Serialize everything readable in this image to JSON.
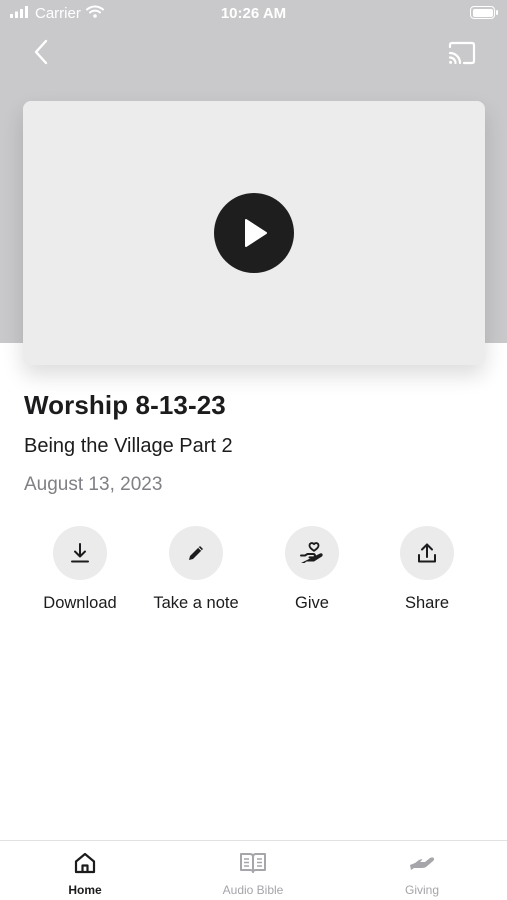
{
  "status_bar": {
    "carrier": "Carrier",
    "time": "10:26 AM"
  },
  "header": {
    "back_icon": "chevron-left-icon",
    "cast_icon": "cast-icon"
  },
  "video": {
    "play_icon": "play-icon"
  },
  "sermon": {
    "title": "Worship 8-13-23",
    "subtitle": "Being the Village Part 2",
    "date": "August 13, 2023"
  },
  "actions": [
    {
      "label": "Download",
      "icon": "download-icon"
    },
    {
      "label": "Take a note",
      "icon": "pencil-icon"
    },
    {
      "label": "Give",
      "icon": "heart-hand-icon"
    },
    {
      "label": "Share",
      "icon": "share-icon"
    }
  ],
  "tabs": [
    {
      "label": "Home",
      "icon": "home-icon",
      "active": true
    },
    {
      "label": "Audio Bible",
      "icon": "book-icon",
      "active": false
    },
    {
      "label": "Giving",
      "icon": "giving-hand-icon",
      "active": false
    }
  ],
  "colors": {
    "hero_background": "#c9c9cb",
    "video_background": "#ececed",
    "play_button": "#1e1e1e",
    "action_circle": "#ebebec",
    "text_primary": "#1c1c1e",
    "text_secondary": "#808085",
    "tab_inactive": "#a5a5aa"
  }
}
